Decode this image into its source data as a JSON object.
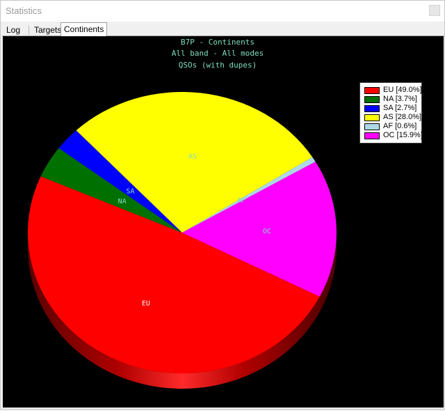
{
  "window": {
    "title": "Statistics"
  },
  "tabs": [
    {
      "label": "Log"
    },
    {
      "label": "Targets"
    },
    {
      "label": "Continents",
      "active": true
    }
  ],
  "chart_data": {
    "type": "pie",
    "title": "B7P - Continents",
    "subtitle": "All band - All modes",
    "subtitle2": "QSOs (with dupes)",
    "slices": [
      {
        "label": "EU",
        "legend": "EU [49.0%]",
        "percent": 49.0,
        "color": "#ff0000"
      },
      {
        "label": "NA",
        "legend": "NA [3.7%]",
        "percent": 3.7,
        "color": "#007000"
      },
      {
        "label": "SA",
        "legend": "SA [2.7%]",
        "percent": 2.7,
        "color": "#0000ff"
      },
      {
        "label": "AS",
        "legend": "AS [28.0%]",
        "percent": 28.0,
        "color": "#ffff00"
      },
      {
        "label": "AF",
        "legend": "AF [0.6%]",
        "percent": 0.6,
        "color": "#add8e6"
      },
      {
        "label": "OC",
        "legend": "OC [15.9%]",
        "percent": 15.9,
        "color": "#ff00ff"
      }
    ],
    "title_color": "#7fdcc0",
    "legend_placement": "top-right"
  }
}
